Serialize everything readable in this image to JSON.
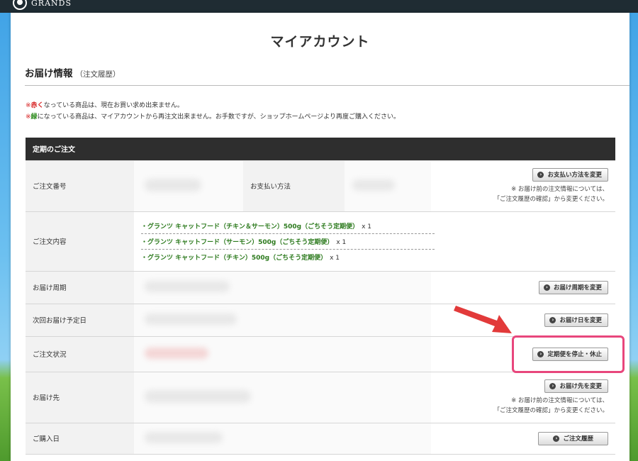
{
  "header": {
    "logo_text": "GRANDS"
  },
  "page": {
    "title": "マイアカウント"
  },
  "section": {
    "title": "お届け情報",
    "subtitle": "（注文履歴）"
  },
  "notes": {
    "line1_prefix": "※",
    "line1_red": "赤く",
    "line1_rest": "なっている商品は、現在お買い求め出来ません。",
    "line2_prefix": "※",
    "line2_green": "緑",
    "line2_rest": "になっている商品は、マイアカウントから再注文出来ません。お手数ですが、ショップホームページより再度ご購入ください。"
  },
  "table": {
    "header": "定期のご注文",
    "rows": {
      "order_number": "ご注文番号",
      "payment_method": "お支払い方法",
      "order_contents": "ご注文内容",
      "delivery_cycle": "お届け周期",
      "next_delivery": "次回お届け予定日",
      "order_status": "ご注文状況",
      "delivery_address": "お届け先",
      "purchase_date": "ご購入日"
    },
    "products": [
      {
        "name": "・グランツ キャットフード（チキン＆サーモン）500g（ごちそう定期便）",
        "qty": "x 1"
      },
      {
        "name": "・グランツ キャットフード（サーモン）500g（ごちそう定期便）",
        "qty": "x 1"
      },
      {
        "name": "・グランツ キャットフード（チキン）500g（ごちそう定期便）",
        "qty": "x 1"
      }
    ],
    "buttons": {
      "change_payment": "お支払い方法を変更",
      "change_cycle": "お届け周期を変更",
      "change_date": "お届け日を変更",
      "stop_pause": "定期便を停止・休止",
      "change_address": "お届け先を変更",
      "order_history": "ご注文履歴"
    },
    "note_line1": "※ お届け前の注文情報については、",
    "note_line2": "「ご注文履歴の確認」から変更ください。"
  },
  "icons": {
    "button_icon": "circle-arrow-right-icon",
    "logo_icon": "grands-logo-icon",
    "arrow_icon": "red-arrow-icon"
  },
  "colors": {
    "accent_highlight": "#e8467c",
    "header_bar": "#2e2e2e",
    "red_text": "#d61d1d",
    "green_text": "#2c8a1d"
  }
}
